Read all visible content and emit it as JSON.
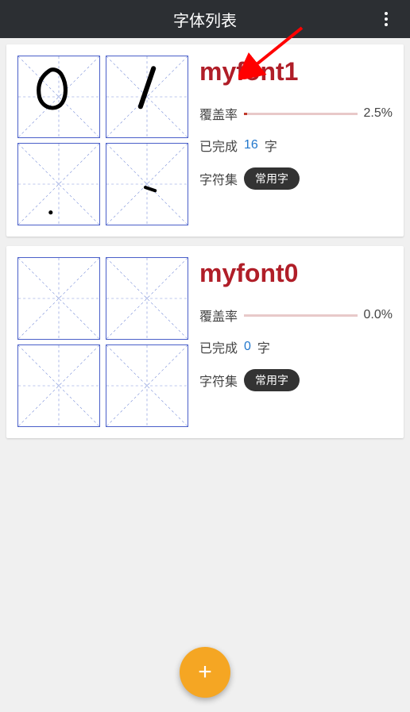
{
  "header": {
    "title": "字体列表"
  },
  "labels": {
    "coverage": "覆盖率",
    "completed": "已完成",
    "charset": "字符集",
    "char_unit": "字"
  },
  "fonts": [
    {
      "name": "myfont1",
      "coverage_text": "2.5%",
      "coverage_pct": 2.5,
      "completed_count": "16",
      "charset_badge": "常用字",
      "previews": [
        "circle",
        "slash",
        "dot-bottom",
        "small-stroke"
      ]
    },
    {
      "name": "myfont0",
      "coverage_text": "0.0%",
      "coverage_pct": 0.0,
      "completed_count": "0",
      "charset_badge": "常用字",
      "previews": [
        "empty",
        "empty",
        "empty",
        "empty"
      ]
    }
  ],
  "colors": {
    "accent": "#b01e28",
    "fab": "#f5a623",
    "header": "#2c2f33",
    "grid_border": "#4a5fc9"
  },
  "annotation": {
    "arrow_color": "#ff0000"
  }
}
